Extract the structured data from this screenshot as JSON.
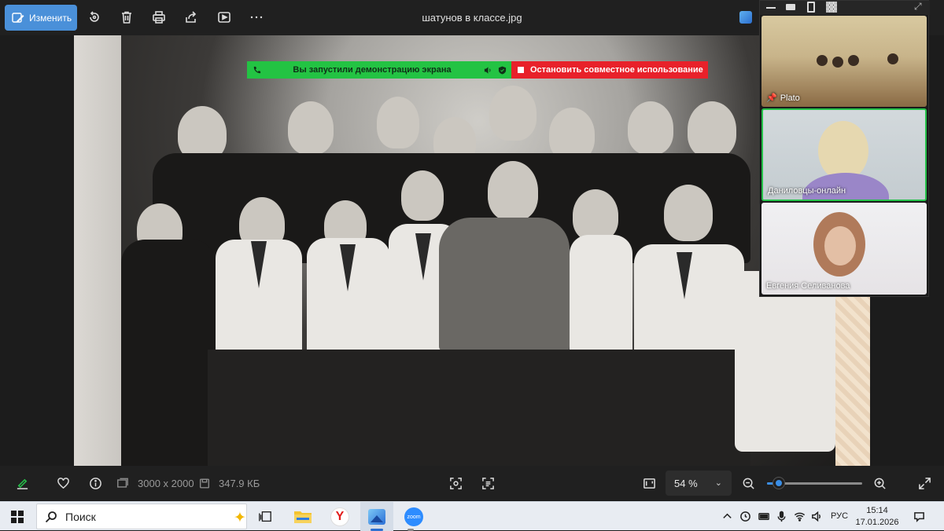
{
  "toolbar": {
    "edit_label": "Изменить",
    "file_title": "шатунов в классе.jpg"
  },
  "share_banner": {
    "sharing_message": "Вы запустили демонстрацию экрана",
    "stop_label": "Остановить совместное использование",
    "green_color": "#23c343",
    "red_color": "#e8212a"
  },
  "zoom": {
    "participants": [
      {
        "name": "Plato",
        "pinned": true
      },
      {
        "name": "Даниловцы-онлайн",
        "active_speaker": true
      },
      {
        "name": "Евгения Селиванова"
      }
    ]
  },
  "image_info": {
    "resolution": "3000 x 2000",
    "file_size": "347.9 КБ",
    "zoom_level": "54 %",
    "zoom_slider_value": 0.12
  },
  "taskbar": {
    "search_placeholder": "Поиск",
    "language": "РУС",
    "time": "15:14",
    "date": "17.01.2026",
    "apps": [
      "task-view",
      "file-explorer",
      "yandex-browser",
      "photos",
      "zoom"
    ],
    "zoom_app_label": "zoom"
  },
  "colors": {
    "accent": "#4a90d9",
    "active_border": "#25c24a"
  }
}
